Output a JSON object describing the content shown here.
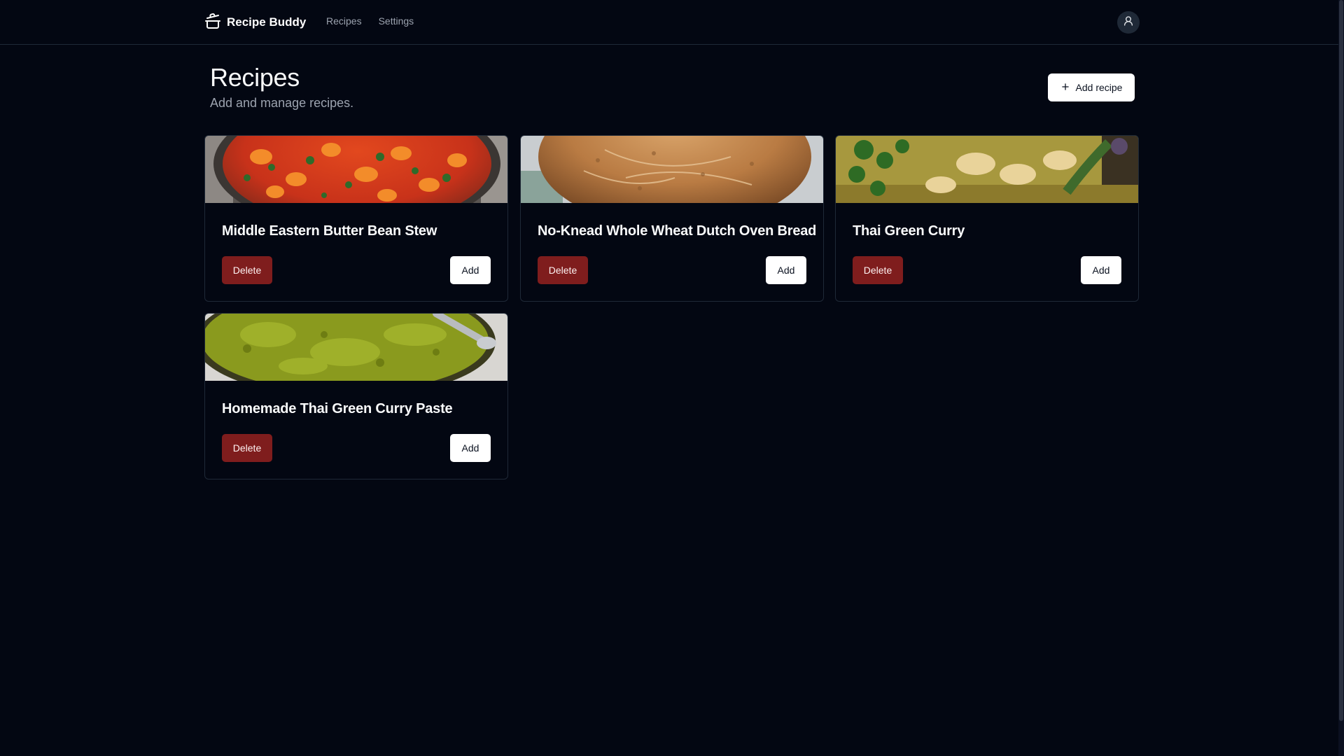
{
  "app": {
    "name": "Recipe Buddy",
    "logo_icon": "cooking-pot-icon"
  },
  "nav": {
    "items": [
      {
        "label": "Recipes"
      },
      {
        "label": "Settings"
      }
    ],
    "avatar_icon": "user-icon"
  },
  "page": {
    "title": "Recipes",
    "subtitle": "Add and manage recipes.",
    "add_button_label": "Add recipe",
    "add_button_icon": "plus-icon"
  },
  "recipes": [
    {
      "title": "Middle Eastern Butter Bean Stew",
      "delete_label": "Delete",
      "add_label": "Add"
    },
    {
      "title": "No-Knead Whole Wheat Dutch Oven Bread",
      "delete_label": "Delete",
      "add_label": "Add"
    },
    {
      "title": "Thai Green Curry",
      "delete_label": "Delete",
      "add_label": "Add"
    },
    {
      "title": "Homemade Thai Green Curry Paste",
      "delete_label": "Delete",
      "add_label": "Add"
    }
  ],
  "colors": {
    "background": "#030712",
    "border": "#1f2937",
    "delete_button": "#7f1d1d",
    "muted_text": "#9ca3af"
  }
}
